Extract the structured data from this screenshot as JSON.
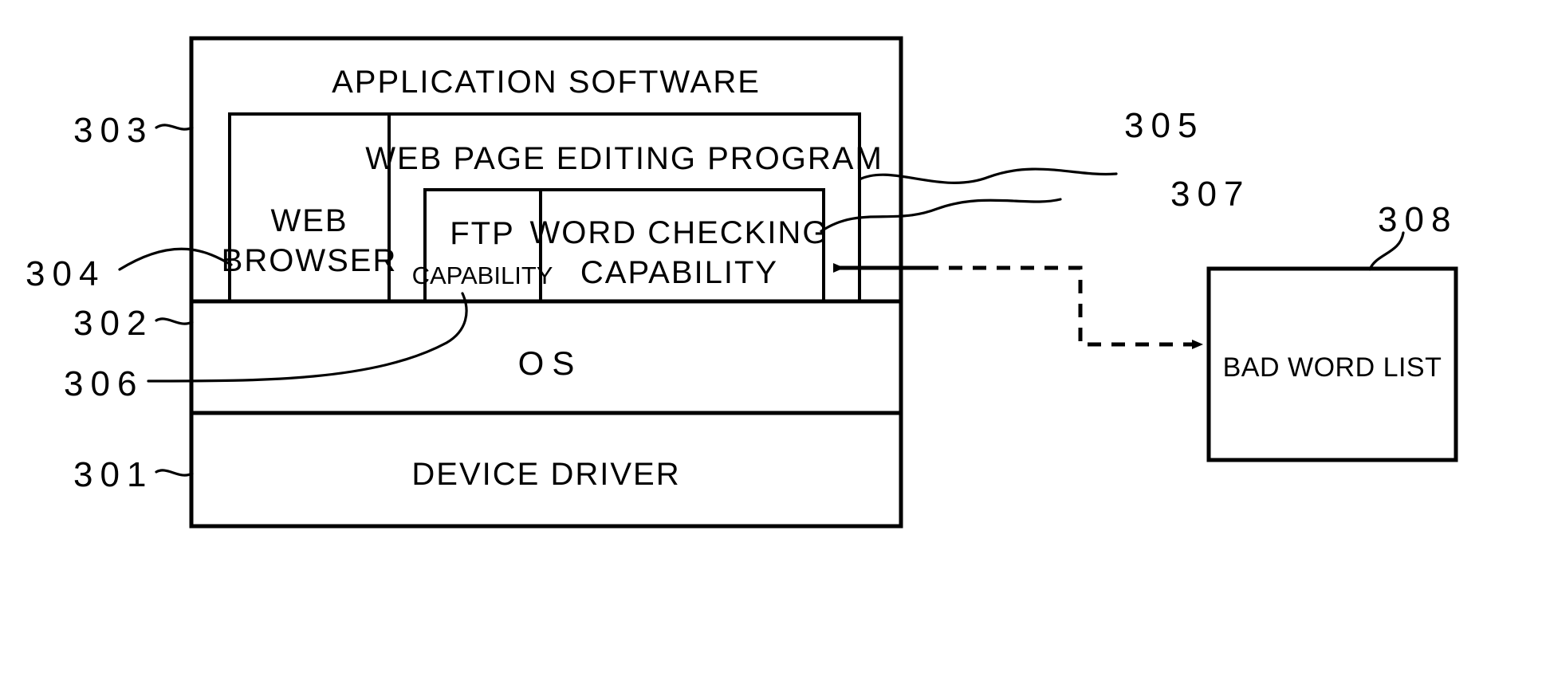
{
  "figure": {
    "type": "patent-block-diagram",
    "description": "Software stack block diagram with application software, OS and device driver layers plus an external bad word list"
  },
  "blocks": {
    "application_software": {
      "label": "APPLICATION SOFTWARE",
      "ref": "303"
    },
    "web_browser": {
      "label_line1": "WEB",
      "label_line2": "BROWSER",
      "ref": "304"
    },
    "web_page_editing_program": {
      "label": "WEB PAGE EDITING PROGRAM",
      "ref": "305"
    },
    "ftp_capability": {
      "label_line1": "FTP",
      "label_line2": "CAPABILITY",
      "ref": "306"
    },
    "word_checking_capability": {
      "label_line1": "WORD CHECKING",
      "label_line2": "CAPABILITY",
      "ref": "307"
    },
    "os": {
      "label": "OS",
      "ref": "302"
    },
    "device_driver": {
      "label": "DEVICE DRIVER",
      "ref": "301"
    },
    "bad_word_list": {
      "label": "BAD WORD LIST",
      "ref": "308"
    }
  },
  "reference_numerals": {
    "r301": "301",
    "r302": "302",
    "r303": "303",
    "r304": "304",
    "r305": "305",
    "r306": "306",
    "r307": "307",
    "r308": "308"
  },
  "connectors": [
    {
      "name": "bad-word-list-to-word-checking",
      "style": "dashed",
      "from": "bad_word_list",
      "to": "word_checking_capability",
      "arrowheads": "both"
    }
  ],
  "colors": {
    "ink": "#000000",
    "paper": "#ffffff"
  }
}
